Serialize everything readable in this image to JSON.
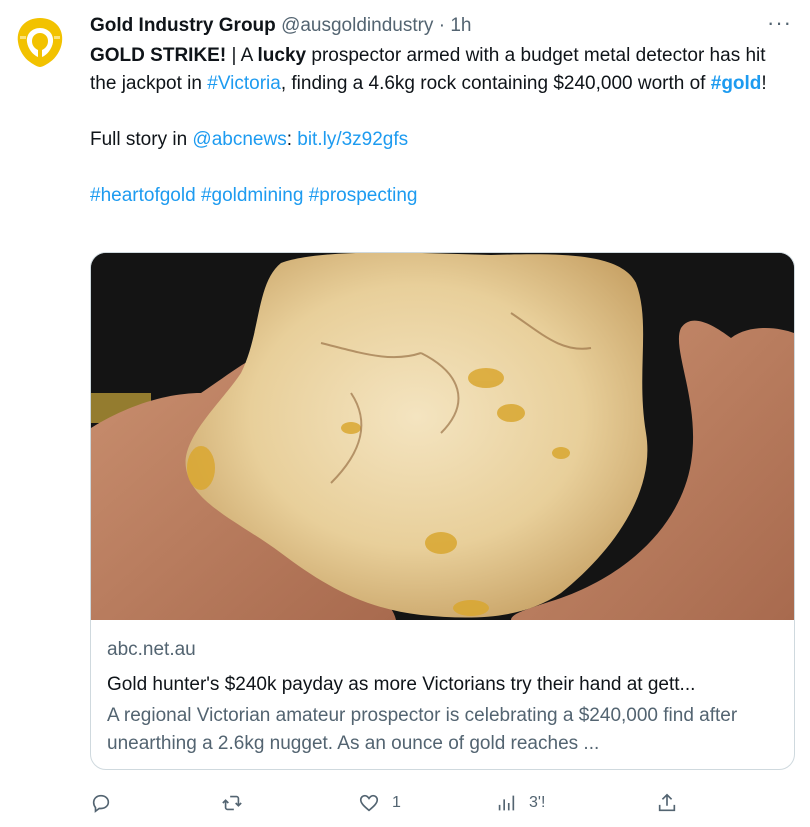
{
  "header": {
    "name": "Gold Industry Group",
    "handle": "@ausgoldindustry",
    "separator": "·",
    "time": "1h",
    "more_label": "···"
  },
  "tweet": {
    "line1_a": "GOLD STRIKE!",
    "line1_b": " | A ",
    "line1_c": "lucky",
    "line1_d": " prospector armed with a budget metal detector has hit the jackpot in ",
    "hashtag_victoria": "#Victoria",
    "line1_e": ", finding a 4.6kg rock containing $240,000 worth of ",
    "hashtag_gold": "#gold",
    "line1_f": "!",
    "story_prefix": "Full story in ",
    "mention": "@abcnews",
    "story_colon": ": ",
    "short_link": "bit.ly/3z92gfs",
    "hashtags": [
      "#heartofgold",
      "#goldmining",
      "#prospecting"
    ]
  },
  "card": {
    "domain": "abc.net.au",
    "title": "Gold hunter's $240k payday as more Victorians try their hand at gett...",
    "description": "A regional Victorian amateur prospector is celebrating a $240,000 find after unearthing a 2.6kg nugget. As an ounce of gold reaches ..."
  },
  "actions": {
    "reply_count": "",
    "retweet_count": "",
    "like_count": "1",
    "views_count": "3'!",
    "share_count": ""
  },
  "icons": {
    "avatar": "gold-ring-logo",
    "reply": "reply-icon",
    "retweet": "retweet-icon",
    "like": "like-icon",
    "views": "views-icon",
    "share": "share-icon"
  },
  "colors": {
    "accent": "#1d9bf0",
    "muted": "#536471",
    "text": "#0f1419",
    "border": "#cfd9de",
    "logo_gold": "#f5c518"
  }
}
